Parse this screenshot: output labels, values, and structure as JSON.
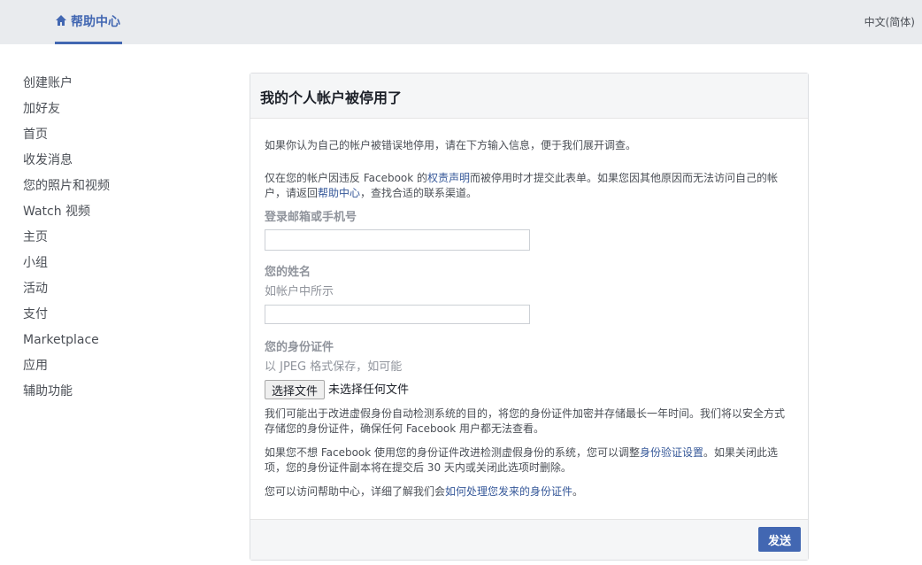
{
  "header": {
    "brand_label": "帮助中心",
    "brand_icon": "home-icon",
    "language": "中文(简体)"
  },
  "sidebar": {
    "items": [
      {
        "label": "创建账户"
      },
      {
        "label": "加好友"
      },
      {
        "label": "首页"
      },
      {
        "label": "收发消息"
      },
      {
        "label": "您的照片和视频"
      },
      {
        "label": "Watch 视频"
      },
      {
        "label": "主页"
      },
      {
        "label": "小组"
      },
      {
        "label": "活动"
      },
      {
        "label": "支付"
      },
      {
        "label": "Marketplace"
      },
      {
        "label": "应用"
      },
      {
        "label": "辅助功能"
      }
    ]
  },
  "form": {
    "title": "我的个人帐户被停用了",
    "intro": "如果你认为自己的帐户被错误地停用，请在下方输入信息，便于我们展开调查。",
    "notice_part1": "仅在您的帐户因违反 Facebook 的",
    "notice_link1": "权责声明",
    "notice_part2": "而被停用时才提交此表单。如果您因其他原因而无法访问自己的帐户，请返回",
    "notice_link2": "帮助中心",
    "notice_part3": "，查找合适的联系渠道。",
    "email_label": "登录邮箱或手机号",
    "email_value": "",
    "name_label": "您的姓名",
    "name_hint": "如帐户中所示",
    "name_value": "",
    "id_label": "您的身份证件",
    "id_hint": "以 JPEG 格式保存，如可能",
    "file_button": "选择文件",
    "file_status": "未选择任何文件",
    "note1": "我们可能出于改进虚假身份自动检测系统的目的，将您的身份证件加密并存储最长一年时间。我们将以安全方式存储您的身份证件，确保任何 Facebook 用户都无法查看。",
    "note2_part1": "如果您不想 Facebook 使用您的身份证件改进检测虚假身份的系统，您可以调整",
    "note2_link": "身份验证设置",
    "note2_part2": "。如果关闭此选项，您的身份证件副本将在提交后 30 天内或关闭此选项时删除。",
    "note3_part1": "您可以访问帮助中心，详细了解我们会",
    "note3_link": "如何处理您发来的身份证件",
    "note3_part2": "。",
    "submit_label": "发送"
  },
  "colors": {
    "brand": "#4267b2",
    "link": "#365899",
    "topbar_bg": "#e9ebee"
  }
}
